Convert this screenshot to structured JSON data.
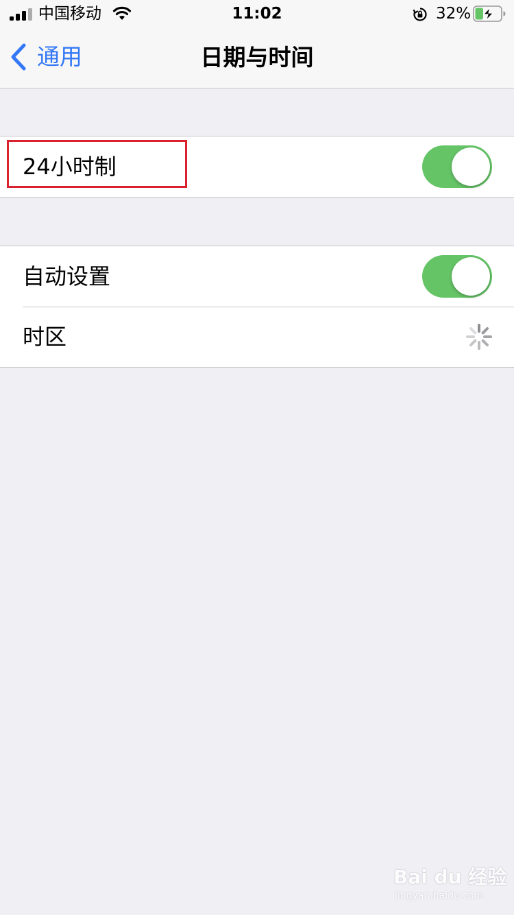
{
  "status_bar": {
    "carrier": "中国移动",
    "time": "11:02",
    "battery_percent": "32%",
    "battery_level": 0.32,
    "icons": [
      "signal-icon",
      "wifi-icon",
      "rotation-lock-icon",
      "battery-charging-icon"
    ]
  },
  "nav": {
    "back_label": "通用",
    "title": "日期与时间",
    "back_icon": "chevron-left-icon"
  },
  "settings": {
    "hour24": {
      "label": "24小时制",
      "on": true
    },
    "auto_set": {
      "label": "自动设置",
      "on": true
    },
    "timezone": {
      "label": "时区",
      "status_icon": "loading-spinner-icon"
    }
  },
  "annotation": {
    "highlight_color": "#d9222e",
    "highlighted_item": "24小时制"
  },
  "watermark": {
    "main": "Bai du 经验",
    "sub": "jingyan.baidu.com"
  },
  "colors": {
    "accent": "#3478f6",
    "toggle_on": "#65c466",
    "background": "#efeff4"
  }
}
